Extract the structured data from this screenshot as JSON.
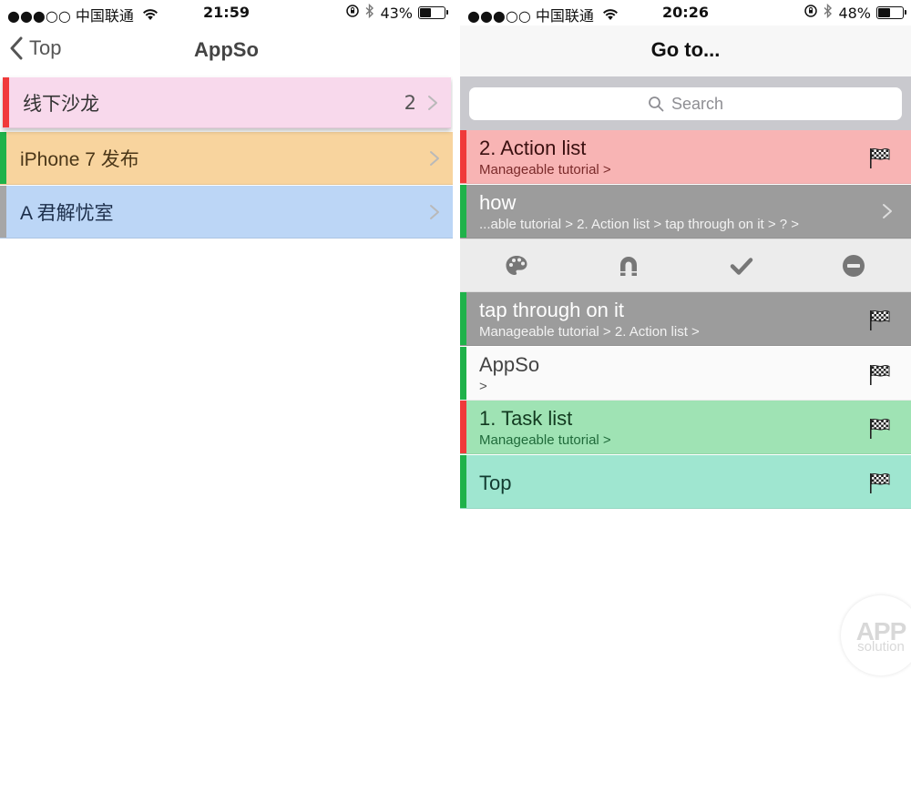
{
  "left_screen": {
    "status": {
      "carrier": "●●●○○ 中国联通",
      "time": "21:59",
      "battery": "43%",
      "battery_level": 0.43
    },
    "nav": {
      "back_label": "Top",
      "title": "AppSo"
    },
    "items": [
      {
        "label": "线下沙龙",
        "count": "2",
        "bg": "#f8d9ec",
        "bar": "#f03a3a",
        "text": "#333333"
      },
      {
        "label": "iPhone 7 发布",
        "count": "",
        "bg": "#f8d49e",
        "bar": "#1fb24a",
        "text": "#4a3618"
      },
      {
        "label": "A 君解忧室",
        "count": "",
        "bg": "#bcd6f6",
        "bar": "#a6a6a6",
        "text": "#1c2e4a"
      }
    ]
  },
  "right_screen": {
    "status": {
      "carrier": "●●●○○ 中国联通",
      "time": "20:26",
      "battery": "48%",
      "battery_level": 0.48
    },
    "nav": {
      "title": "Go to..."
    },
    "search": {
      "placeholder": "Search"
    },
    "items_top": [
      {
        "title": "2. Action list",
        "subtitle": "Manageable tutorial >",
        "bg": "#f8b4b4",
        "bar": "#f03a3a",
        "title_color": "#3a1010",
        "sub_color": "#7a2a2a",
        "trailing": "flag-icon"
      },
      {
        "title": "how",
        "subtitle": "...able tutorial > 2. Action list > tap through on it > ?  >",
        "bg": "#9c9c9c",
        "bar": "#1fb24a",
        "title_color": "#ffffff",
        "sub_color": "#f2f2f2",
        "trailing": "chevron-right-icon"
      }
    ],
    "actions": [
      "palette-icon",
      "magnet-icon",
      "checkmark-icon",
      "minus-circle-icon"
    ],
    "items_bottom": [
      {
        "title": "tap through on it",
        "subtitle": "Manageable tutorial > 2. Action list >",
        "bg": "#9c9c9c",
        "bar": "#1fb24a",
        "title_color": "#ffffff",
        "sub_color": "#f2f2f2",
        "trailing": "flag-icon"
      },
      {
        "title": "AppSo",
        "subtitle": ">",
        "bg": "#fafafa",
        "bar": "#1fb24a",
        "title_color": "#444444",
        "sub_color": "#555555",
        "trailing": "flag-icon"
      },
      {
        "title": "1. Task list",
        "subtitle": "Manageable tutorial >",
        "bg": "#9fe3b4",
        "bar": "#f03a3a",
        "title_color": "#123a20",
        "sub_color": "#1f6a3a",
        "trailing": "flag-icon"
      },
      {
        "title": "Top",
        "subtitle": "",
        "bg": "#9fe6d0",
        "bar": "#1fb24a",
        "title_color": "#123a30",
        "sub_color": "#1f6a50",
        "trailing": "flag-icon"
      }
    ]
  },
  "watermark": {
    "line1": "APP",
    "line2": "solution"
  }
}
